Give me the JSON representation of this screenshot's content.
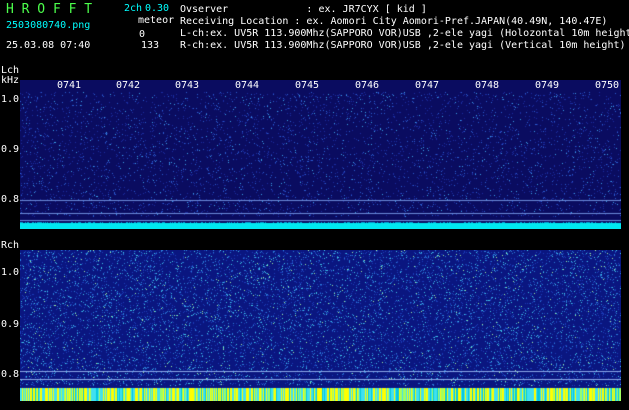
{
  "app": {
    "title": "H R O F F T",
    "channels": "2ch",
    "version": "0.30",
    "filename": "2503080740.png",
    "datetime": "25.03.08 07:40",
    "meteor_label": "meteor",
    "meteor_lch": "0",
    "meteor_rch": "133"
  },
  "info": {
    "observer": "Ovserver             : ex. JR7CYX [ kid ]",
    "location": "Receiving Location : ex. Aomori City Aomori-Pref.JAPAN(40.49N, 140.47E)",
    "lch": "L-ch:ex. UV5R 113.900Mhz(SAPPORO VOR)USB ,2-ele yagi (Holozontal 10m height)",
    "rch": "R-ch:ex. UV5R 113.900Mhz(SAPPORO VOR)USB ,2-ele yagi (Vertical 10m height)"
  },
  "lch_panel": {
    "label": "Lch",
    "unit": "kHz",
    "y_ticks": [
      "1.0",
      "0.9",
      "0.8"
    ],
    "time_ticks": [
      "0741",
      "0742",
      "0743",
      "0744",
      "0745",
      "0746",
      "0747",
      "0748",
      "0749",
      "0750"
    ]
  },
  "rch_panel": {
    "label": "Rch",
    "y_ticks": [
      "1.0",
      "0.9",
      "0.8"
    ]
  },
  "colors": {
    "title": "#4cff4c",
    "info": "#ffffff",
    "cyan": "#00ffff",
    "panel_bg_l": "#0a0c60",
    "panel_bg_r": "#0a1680",
    "noise_yellow": "#ffff00"
  }
}
